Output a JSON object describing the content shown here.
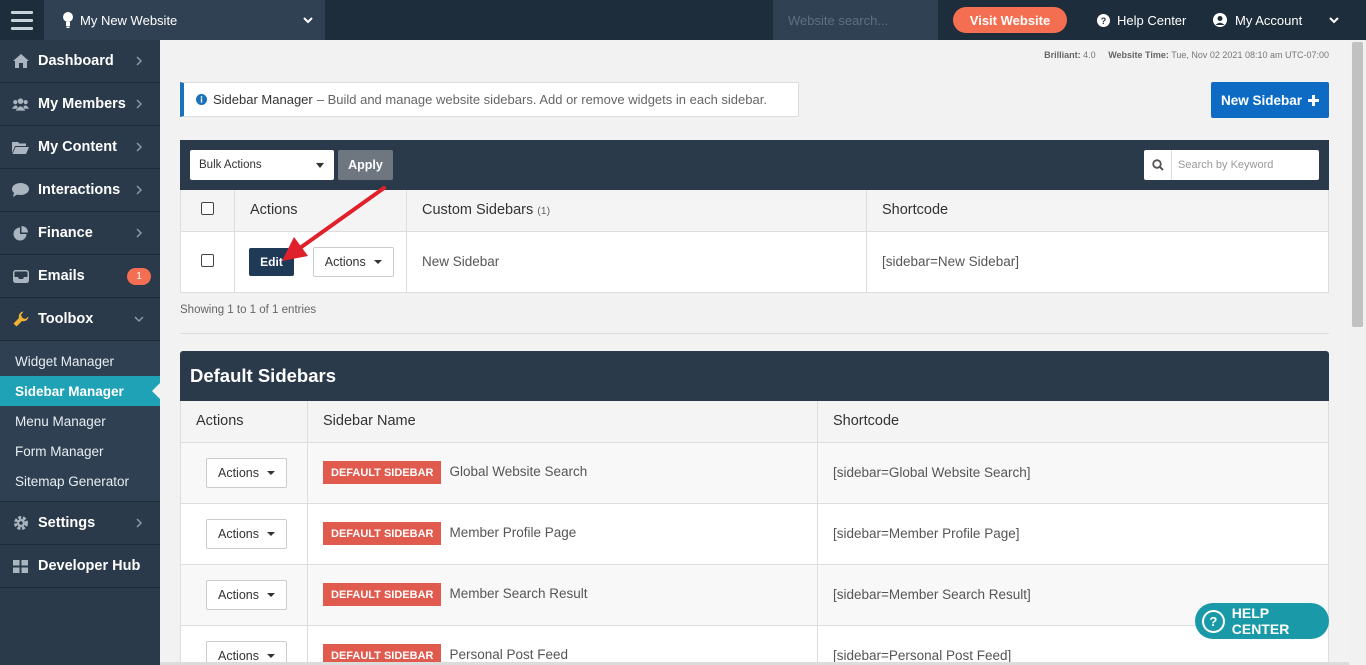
{
  "topbar": {
    "site_name": "My New Website",
    "search_placeholder": "Website search...",
    "visit_label": "Visit Website",
    "help_label": "Help Center",
    "account_label": "My Account"
  },
  "sidebar": {
    "items": [
      {
        "label": "Dashboard",
        "icon": "home-icon"
      },
      {
        "label": "My Members",
        "icon": "users-icon"
      },
      {
        "label": "My Content",
        "icon": "folder-icon"
      },
      {
        "label": "Interactions",
        "icon": "chat-icon"
      },
      {
        "label": "Finance",
        "icon": "pie-chart-icon"
      },
      {
        "label": "Emails",
        "icon": "inbox-icon",
        "badge": "1"
      },
      {
        "label": "Toolbox",
        "icon": "wrench-icon"
      }
    ],
    "toolbox_sub": [
      "Widget Manager",
      "Sidebar Manager",
      "Menu Manager",
      "Form Manager",
      "Sitemap Generator"
    ],
    "after_items": [
      {
        "label": "Settings",
        "icon": "gear-icon"
      },
      {
        "label": "Developer Hub",
        "icon": "grid-icon"
      }
    ]
  },
  "meta": {
    "brilliant_label": "Brilliant:",
    "brilliant_version": "4.0",
    "time_label": "Website Time:",
    "time_value": "Tue, Nov 02 2021 08:10 am UTC-07:00"
  },
  "info": {
    "title": "Sidebar Manager",
    "text": "– Build and manage website sidebars. Add or remove widgets in each sidebar."
  },
  "new_sidebar_label": "New Sidebar",
  "toolbar": {
    "bulk_label": "Bulk Actions",
    "apply_label": "Apply",
    "search_placeholder": "Search by Keyword"
  },
  "custom_table": {
    "col_actions": "Actions",
    "col_name": "Custom Sidebars",
    "col_count": "(1)",
    "col_shortcode": "Shortcode",
    "row": {
      "edit": "Edit",
      "actions": "Actions",
      "name": "New Sidebar",
      "shortcode": "[sidebar=New Sidebar]"
    },
    "showing": "Showing 1 to 1 of 1 entries"
  },
  "default_section": {
    "title": "Default Sidebars",
    "col_actions": "Actions",
    "col_name": "Sidebar Name",
    "col_shortcode": "Shortcode",
    "badge": "DEFAULT SIDEBAR",
    "rows": [
      {
        "actions": "Actions",
        "name": "Global Website Search",
        "shortcode": "[sidebar=Global Website Search]"
      },
      {
        "actions": "Actions",
        "name": "Member Profile Page",
        "shortcode": "[sidebar=Member Profile Page]"
      },
      {
        "actions": "Actions",
        "name": "Member Search Result",
        "shortcode": "[sidebar=Member Search Result]"
      },
      {
        "actions": "Actions",
        "name": "Personal Post Feed",
        "shortcode": "[sidebar=Personal Post Feed]"
      }
    ]
  },
  "help_float_label": "HELP CENTER",
  "colors": {
    "accent": "#1fa2b6",
    "brand_dark": "#2a3a4a",
    "cta": "#f46e51",
    "primary": "#0d6bc4",
    "annotation_arrow": "#e0202a"
  }
}
